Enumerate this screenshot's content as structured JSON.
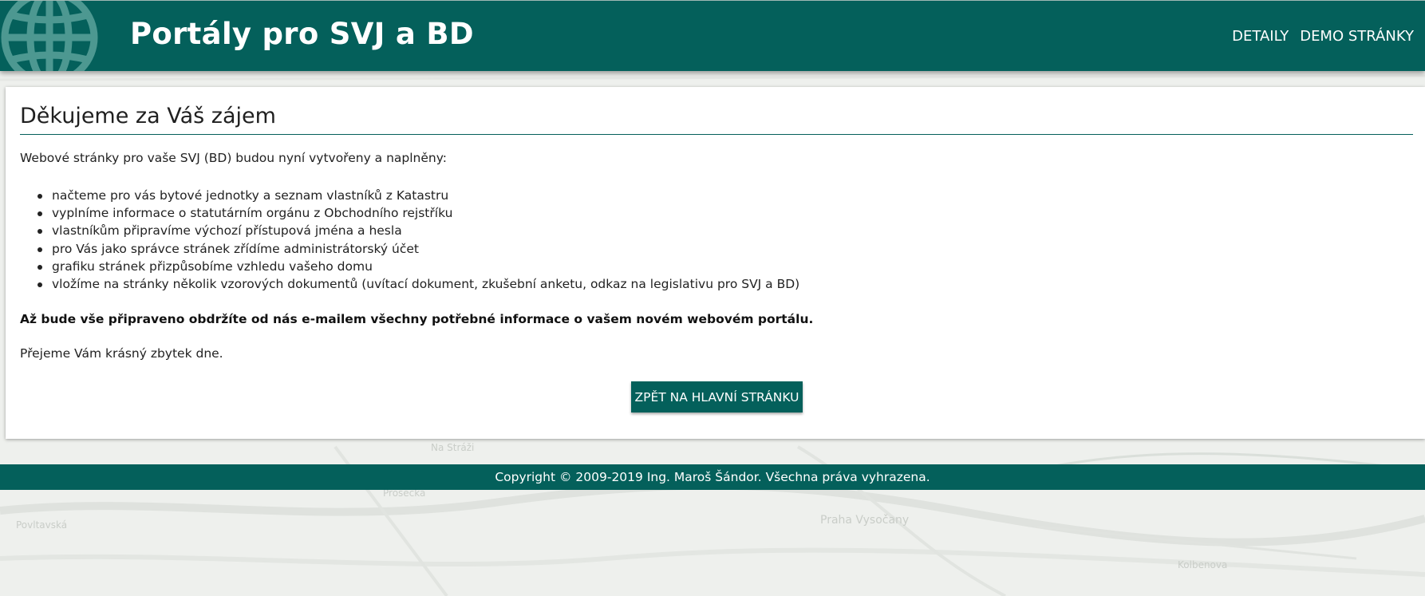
{
  "header": {
    "brand": "Portály pro SVJ a BD",
    "nav": [
      {
        "label": "DETAILY"
      },
      {
        "label": "DEMO STRÁNKY"
      }
    ]
  },
  "main": {
    "title": "Děkujeme za Váš zájem",
    "intro": "Webové stránky pro vaše SVJ (BD) budou nyní vytvořeny a naplněny:",
    "items": [
      "načteme pro vás bytové jednotky a seznam vlastníků z Katastru",
      "vyplníme informace o statutárním orgánu z Obchodního rejstříku",
      "vlastníkům připravíme výchozí přístupová jména a hesla",
      "pro Vás jako správce stránek zřídíme administrátorský účet",
      "grafiku stránek přizpůsobíme vzhledu vašeho domu",
      "vložíme na stránky několik vzorových dokumentů (uvítací dokument, zkušební anketu, odkaz na legislativu pro SVJ a BD)"
    ],
    "notice": "Až bude vše připraveno obdržíte od nás e-mailem všechny potřebné informace o vašem novém webovém portálu.",
    "farewell": "Přejeme Vám krásný zbytek dne.",
    "back_button": "ZPĚT NA HLAVNÍ STRÁNKU"
  },
  "footer": {
    "copyright": "Copyright © 2009-2019 Ing. Maroš Šándor. Všechna práva vyhrazena."
  },
  "map_labels": [
    "Povltavská",
    "Prosecká",
    "Praha Vysočany",
    "Kolbenova",
    "Na Stráži"
  ],
  "colors": {
    "brand_teal": "#04605b",
    "background": "#f0f1ef",
    "card": "#ffffff"
  }
}
